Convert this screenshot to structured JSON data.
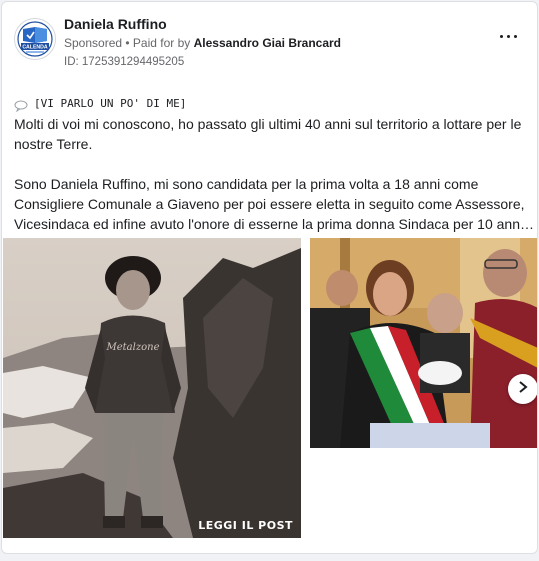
{
  "post": {
    "author": "Daniela Ruffino",
    "sponsored": "Sponsored",
    "separator": " • ",
    "paid_prefix": "Paid for by ",
    "paid_by": "Alessandro Giai Brancard",
    "ad_id": "ID: 1725391294495205",
    "logo_text": "CALENDA",
    "tag_line": "[VI PARLO UN PO' DI ME]",
    "paragraph1": "Molti di voi mi conoscono, ho passato gli ultimi 40 anni sul territorio a lottare per le nostre Terre.",
    "paragraph2": "Sono Daniela Ruffino, mi sono candidata per la prima volta a 18 anni come Consigliere Comunale a Giaveno per poi essere eletta in seguito come Assessore, Vicesindaca ed infine avuto l'onore di esserne la prima donna Sindaca per 10 ann…",
    "image1_caption": "LEGGI IL POST",
    "image1_shirt_text": "Metalzone"
  },
  "colors": {
    "logo_blue": "#1f4fa0",
    "sash_green": "#1f8a3a",
    "sash_red": "#c8202a"
  },
  "icons": {
    "more": "more-options-icon",
    "speech": "speech-bubble-icon",
    "next": "chevron-right-icon"
  }
}
